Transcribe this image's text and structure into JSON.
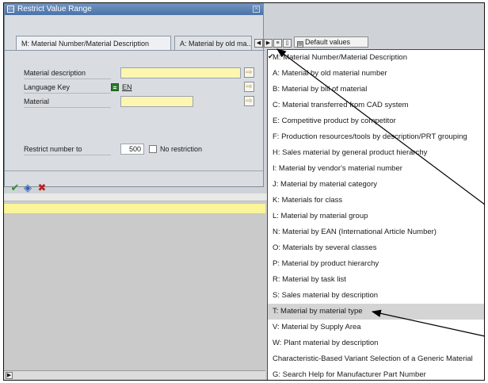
{
  "dialog": {
    "title": "Restrict Value Range",
    "tabs": [
      {
        "label": "M: Material Number/Material Description"
      },
      {
        "label": "A: Material by old ma..."
      }
    ],
    "fields": {
      "material_description": {
        "label": "Material description",
        "value": ""
      },
      "language_key": {
        "label": "Language Key",
        "value": "EN"
      },
      "material": {
        "label": "Material",
        "value": ""
      },
      "restrict_number": {
        "label": "Restrict number to",
        "value": "500"
      },
      "no_restriction": {
        "label": "No restriction",
        "checked": false
      }
    },
    "footer_icons": [
      "checkmark-icon",
      "search-refresh-icon",
      "cancel-icon"
    ]
  },
  "toolbar": {
    "default_values_label": "Default values"
  },
  "menu": {
    "items": [
      {
        "label": "M: Material Number/Material Description",
        "checked": true
      },
      {
        "label": "A: Material by old material number"
      },
      {
        "label": "B: Material by bill of material"
      },
      {
        "label": "C: Material transferred from CAD system"
      },
      {
        "label": "E: Competitive product by competitor"
      },
      {
        "label": "F: Production resources/tools by description/PRT grouping"
      },
      {
        "label": "H: Sales material by general product hierarchy"
      },
      {
        "label": "I: Material by vendor's material number"
      },
      {
        "label": "J: Material by material category"
      },
      {
        "label": "K: Materials for class"
      },
      {
        "label": "L: Material by material group"
      },
      {
        "label": "N: Material by EAN (International Article Number)"
      },
      {
        "label": "O: Materials by several classes"
      },
      {
        "label": "P: Material by product hierarchy"
      },
      {
        "label": "R: Material by task list"
      },
      {
        "label": "S: Sales material by description"
      },
      {
        "label": "T: Material by material type",
        "selected": true
      },
      {
        "label": "V: Material by Supply Area"
      },
      {
        "label": "W: Plant material by description"
      },
      {
        "label": "Characteristic-Based Variant Selection of a Generic Material"
      },
      {
        "label": "G: Search Help for Manufacturer Part Number"
      }
    ]
  },
  "colors": {
    "title_bar": "#4a72a8",
    "required_field": "#fdf6b0",
    "selected_menu_item": "#d4d4d4"
  }
}
